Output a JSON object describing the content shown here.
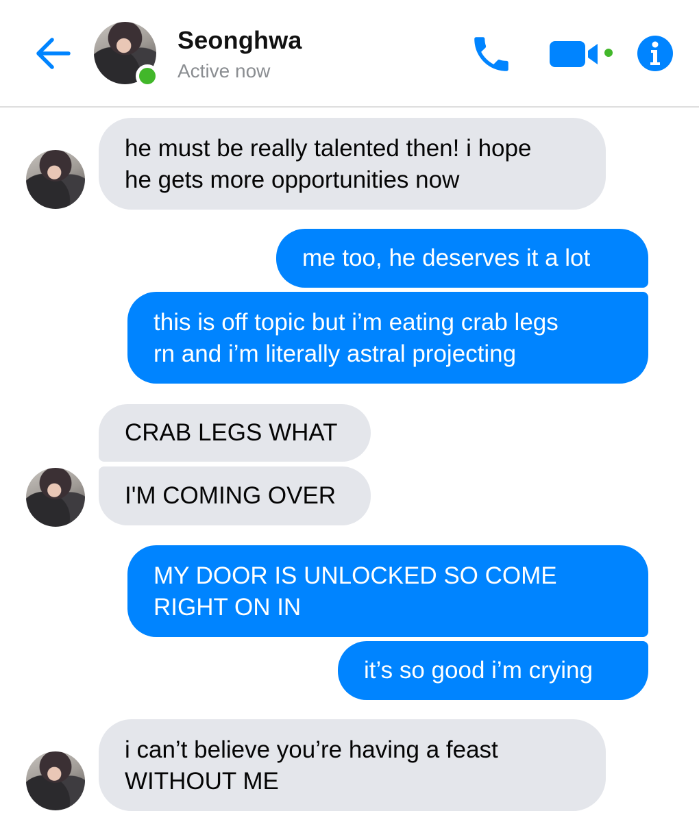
{
  "header": {
    "contact_name": "Seonghwa",
    "status": "Active now",
    "accent_color": "#0084ff",
    "online_color": "#42b72a",
    "icons": [
      "back-arrow-icon",
      "phone-icon",
      "video-camera-icon",
      "info-icon"
    ]
  },
  "messages": [
    {
      "sender": "Seonghwa",
      "direction": "incoming",
      "text": "he must be really talented then! i hope\nhe gets more opportunities now"
    },
    {
      "sender": "me",
      "direction": "outgoing",
      "text": "me too, he deserves it a lot"
    },
    {
      "sender": "me",
      "direction": "outgoing",
      "text": "this is off topic but i’m eating crab legs\nrn and i’m literally astral projecting"
    },
    {
      "sender": "Seonghwa",
      "direction": "incoming",
      "text": "CRAB LEGS WHAT"
    },
    {
      "sender": "Seonghwa",
      "direction": "incoming",
      "text": "I'M COMING OVER"
    },
    {
      "sender": "me",
      "direction": "outgoing",
      "text": "MY DOOR IS UNLOCKED SO COME\nRIGHT ON IN"
    },
    {
      "sender": "me",
      "direction": "outgoing",
      "text": "it’s so good i’m crying"
    },
    {
      "sender": "Seonghwa",
      "direction": "incoming",
      "text": "i can’t believe you’re having a feast\nWITHOUT ME"
    }
  ],
  "colors": {
    "incoming_bubble": "#e4e6eb",
    "outgoing_bubble": "#0084ff"
  }
}
